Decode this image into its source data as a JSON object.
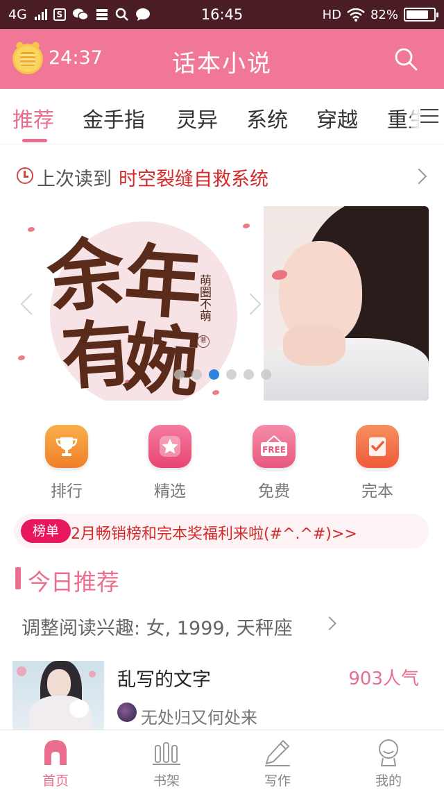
{
  "status_bar": {
    "network": "4G",
    "time": "16:45",
    "hd": "HD",
    "battery": "82%",
    "battery_level": 0.82
  },
  "header": {
    "timer": "24:37",
    "title": "话本小说",
    "icons": {
      "left": "alarm-coin-icon",
      "right": "search-icon"
    }
  },
  "tabs": {
    "items": [
      {
        "label": "推荐",
        "active": true
      },
      {
        "label": "金手指"
      },
      {
        "label": "灵异"
      },
      {
        "label": "系统"
      },
      {
        "label": "穿越"
      },
      {
        "label": "重生"
      }
    ],
    "menu_icon": "hamburger-menu-icon"
  },
  "last_read": {
    "label": "上次读到",
    "book": "时空裂缝自救系统"
  },
  "banner": {
    "title_chars": [
      "余",
      "年",
      "有",
      "婉"
    ],
    "author": "萌圈不萌",
    "stamp": "著",
    "dots": 6,
    "active_dot": 2
  },
  "quick_entries": [
    {
      "label": "排行",
      "icon": "trophy-icon",
      "color": "#f5973a"
    },
    {
      "label": "精选",
      "icon": "star-icon",
      "color": "#ef5a86"
    },
    {
      "label": "免费",
      "icon": "free-sign-icon",
      "color": "#ea6a8c",
      "icon_text": "FREE"
    },
    {
      "label": "完本",
      "icon": "checked-book-icon",
      "color": "#f26a4a"
    }
  ],
  "notice": {
    "badge": "榜单",
    "text": "2月畅销榜和完本奖福利来啦(#^.^#)>>"
  },
  "section": {
    "title": "今日推荐",
    "interest": "调整阅读兴趣: 女, 1999, 天秤座"
  },
  "book": {
    "title": "乱写的文字",
    "popularity": "903人气",
    "author": "无处归又何处来"
  },
  "bottom_nav": [
    {
      "label": "首页",
      "icon": "home-icon",
      "active": true
    },
    {
      "label": "书架",
      "icon": "bookshelf-icon"
    },
    {
      "label": "写作",
      "icon": "pencil-icon"
    },
    {
      "label": "我的",
      "icon": "profile-icon"
    }
  ],
  "colors": {
    "header_pink": "#f07896",
    "accent_pink": "#e8708e",
    "status_bar": "#4a1d24",
    "highlight_red": "#d42a2a",
    "badge_magenta": "#e8175d",
    "dot_active_blue": "#2f83e0"
  }
}
